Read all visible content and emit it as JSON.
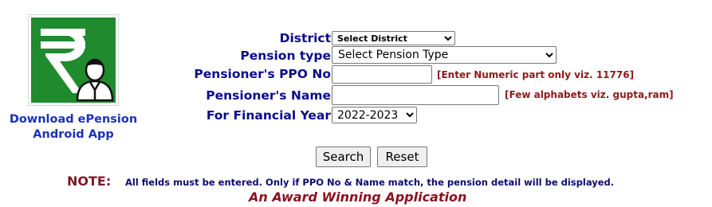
{
  "logo": {
    "icon": "rupee-person-icon"
  },
  "app_link": {
    "line1": "Download ePension",
    "line2": "Android App"
  },
  "form": {
    "district_label": "District",
    "district_value": "Select District",
    "pension_type_label": "Pension type",
    "pension_type_value": "Select Pension Type",
    "ppo_label": "Pensioner's PPO No",
    "ppo_value": "",
    "ppo_hint": "[Enter Numeric part only viz. 11776]",
    "name_label": "Pensioner's Name",
    "name_value": "",
    "name_hint": "[Few alphabets viz. gupta,ram]",
    "fy_label": "For Financial Year",
    "fy_value": "2022-2023"
  },
  "buttons": {
    "search": "Search",
    "reset": "Reset"
  },
  "note": {
    "label": "NOTE:",
    "text": "All fields must be entered. Only if PPO No & Name match, the pension detail will be displayed."
  },
  "tagline": "An Award Winning Application",
  "colors": {
    "label_blue": "#0b0b8c",
    "hint_red": "#8b1a1a",
    "logo_green": "#1f8a2e",
    "link_blue": "#1a31b8"
  }
}
